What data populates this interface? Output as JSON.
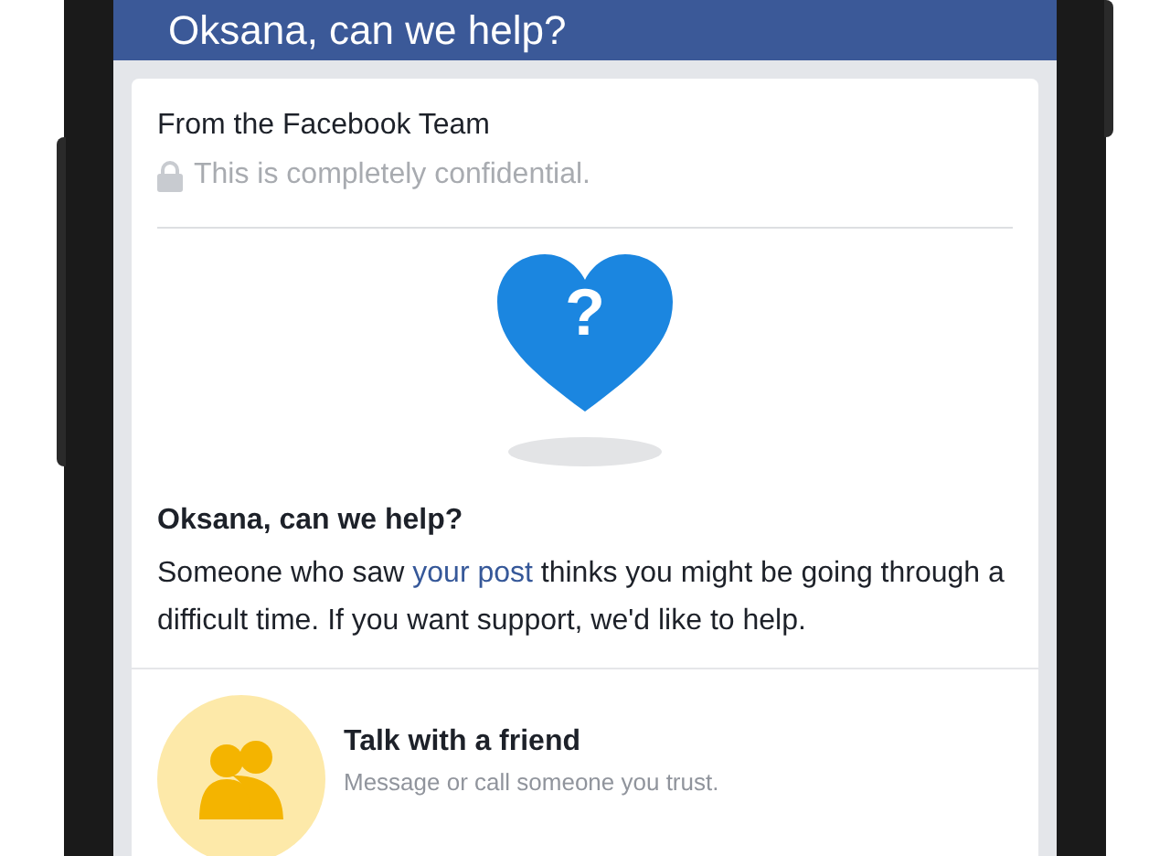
{
  "header": {
    "title": "Oksana, can we help?"
  },
  "card": {
    "from": "From the Facebook Team",
    "confidential": "This is completely confidential.",
    "heart_mark": "?",
    "title": "Oksana, can we help?",
    "body": {
      "before": "Someone who saw ",
      "link": "your post",
      "after": " thinks you might be going through a difficult time. If you want support, we'd like to help."
    }
  },
  "options": [
    {
      "title": "Talk with a friend",
      "subtitle": "Message or call someone you trust."
    }
  ]
}
